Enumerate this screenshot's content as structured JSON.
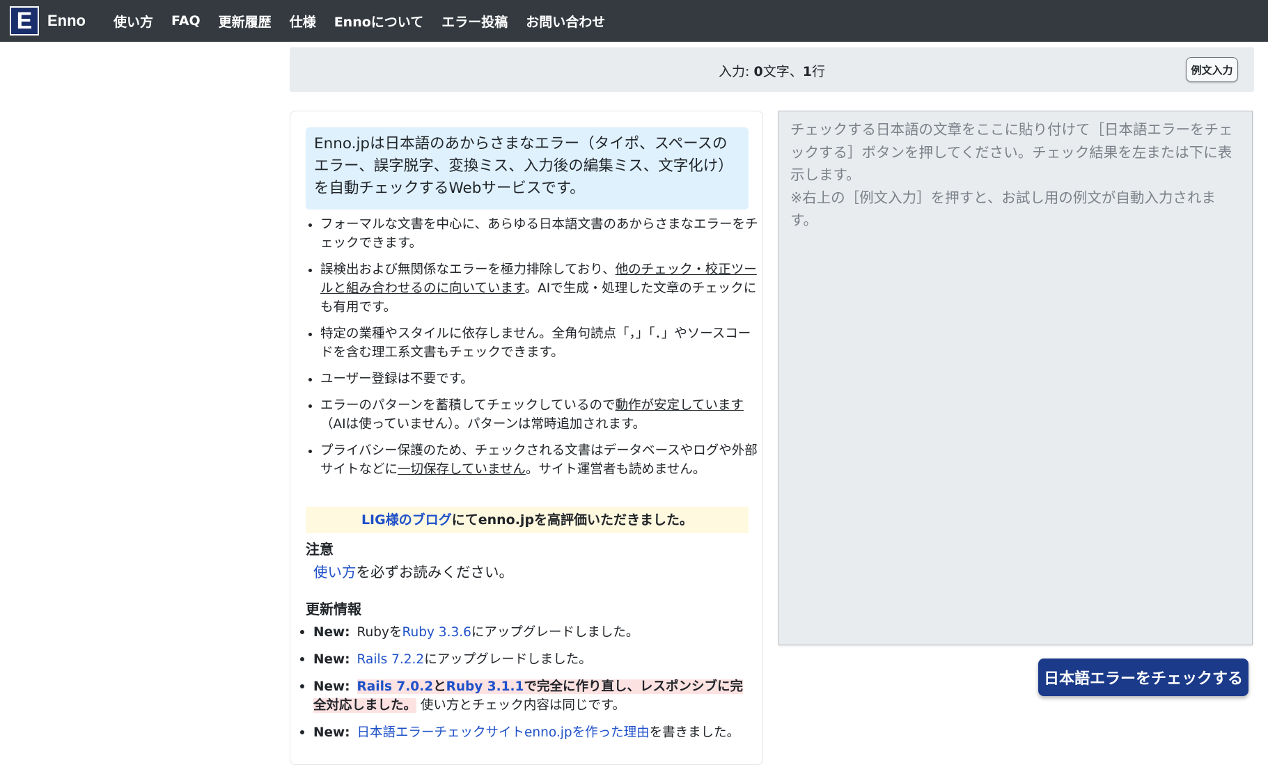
{
  "nav": {
    "logo_letter": "E",
    "brand": "Enno",
    "links": [
      "使い方",
      "FAQ",
      "更新履歴",
      "仕様",
      "Ennoについて",
      "エラー投稿",
      "お問い合わせ"
    ]
  },
  "counter": {
    "prefix": "入力: ",
    "chars": "0",
    "chars_unit": "文字、",
    "lines": "1",
    "lines_unit": "行"
  },
  "example_button": "例文入力",
  "intro": "Enno.jpは日本語のあからさまなエラー（タイポ、スペースのエラー、誤字脱字、変換ミス、入力後の編集ミス、文字化け）を自動チェックするWebサービスです。",
  "features": {
    "f1": "フォーマルな文書を中心に、あらゆる日本語文書のあからさまなエラーをチェックできます。",
    "f2_a": "誤検出および無関係なエラーを極力排除しており、",
    "f2_u": "他のチェック・校正ツールと組み合わせるのに向いています",
    "f2_b": "。AIで生成・処理した文章のチェックにも有用です。",
    "f3": "特定の業種やスタイルに依存しません。全角句読点「，」「．」やソースコードを含む理工系文書もチェックできます。",
    "f4": "ユーザー登録は不要です。",
    "f5_a": "エラーのパターンを蓄積してチェックしているので",
    "f5_u": "動作が安定しています",
    "f5_b": "（AIは使っていません）。パターンは常時追加されます。",
    "f6_a": "プライバシー保護のため、チェックされる文書はデータベースやログや外部サイトなどに",
    "f6_u": "一切保存していません",
    "f6_b": "。サイト運営者も読めません。"
  },
  "lig": {
    "link": "LIG様のブログ",
    "text": "にてenno.jpを高評価いただきました。"
  },
  "notice": {
    "heading": "注意",
    "link": "使い方",
    "text": "を必ずお読みください。"
  },
  "updates": {
    "heading": "更新情報",
    "new_label": "New:",
    "u1_a": "Rubyを",
    "u1_link": "Ruby 3.3.6",
    "u1_b": "にアップグレードしました。",
    "u2_link": "Rails 7.2.2",
    "u2_b": "にアップグレードしました。",
    "u3_link1": "Rails 7.0.2",
    "u3_mid": "と",
    "u3_link2": "Ruby 3.1.1",
    "u3_hl": "で完全に作り直し、レスポンシブに完全対応しました。",
    "u3_b": "使い方とチェック内容は同じです。",
    "u4_link": "日本語エラーチェックサイトenno.jpを作った理由",
    "u4_b": "を書きました。"
  },
  "editor_placeholder": "チェックする日本語の文章をここに貼り付けて［日本語エラーをチェックする］ボタンを押してください。チェック結果を左または下に表示します。\n※右上の［例文入力］を押すと、お試し用の例文が自動入力されます。",
  "check_button": "日本語エラーをチェックする",
  "colors": {
    "navbar": "#343a40",
    "logo": "#1a2e6b",
    "intro_bg": "#dff1fd",
    "lig_bg": "#fff9e0",
    "highlight": "#fde2e2",
    "link": "#1e50c8",
    "check_button": "#1b3a8a"
  }
}
